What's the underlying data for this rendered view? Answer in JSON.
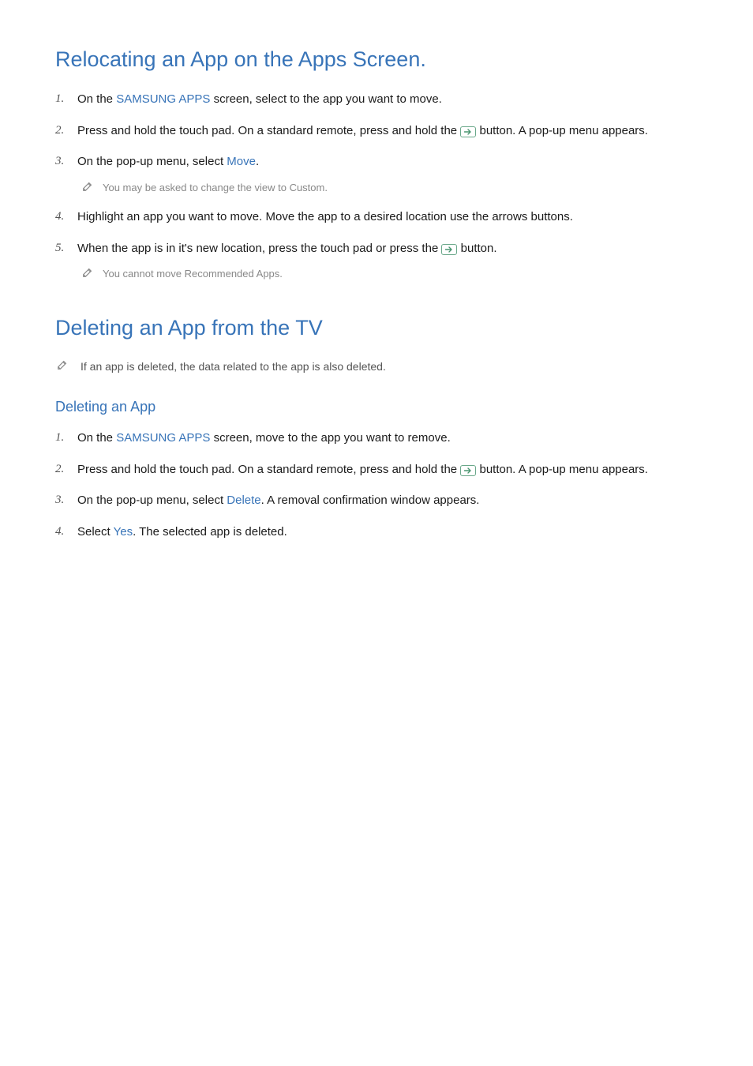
{
  "section1": {
    "title": "Relocating an App on the Apps Screen.",
    "steps": {
      "s1": {
        "pre": "On the ",
        "kw": "SAMSUNG APPS",
        "post": " screen, select to the app you want to move."
      },
      "s2": {
        "pre": "Press and hold the touch pad. On a standard remote, press and hold the ",
        "post": " button. A pop-up menu appears."
      },
      "s3": {
        "pre": "On the pop-up menu, select ",
        "kw": "Move",
        "post": ".",
        "note": "You may be asked to change the view to Custom."
      },
      "s4": {
        "text": "Highlight an app you want to move. Move the app to a desired location use the arrows buttons."
      },
      "s5": {
        "pre": "When the app is in it's new location, press the touch pad or press the ",
        "post": " button.",
        "note": "You cannot move Recommended Apps."
      }
    }
  },
  "section2": {
    "title": "Deleting an App from the TV",
    "note": "If an app is deleted, the data related to the app is also deleted.",
    "sub": {
      "title": "Deleting an App",
      "steps": {
        "s1": {
          "pre": "On the ",
          "kw": "SAMSUNG APPS",
          "post": " screen, move to the app you want to remove."
        },
        "s2": {
          "pre": "Press and hold the touch pad. On a standard remote, press and hold the ",
          "post": " button. A pop-up menu appears."
        },
        "s3": {
          "pre": "On the pop-up menu, select ",
          "kw": "Delete",
          "post": ". A removal confirmation window appears."
        },
        "s4": {
          "pre": "Select ",
          "kw": "Yes",
          "post": ". The selected app is deleted."
        }
      }
    }
  },
  "numbers": {
    "n1": "1.",
    "n2": "2.",
    "n3": "3.",
    "n4": "4.",
    "n5": "5."
  }
}
